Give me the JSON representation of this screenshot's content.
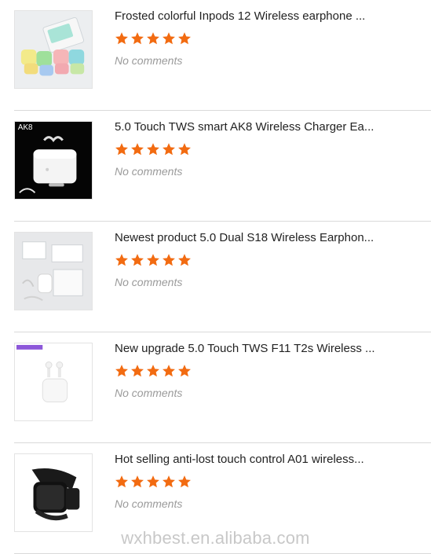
{
  "colors": {
    "star": "#f26b11",
    "divider": "#d9d9d9",
    "title": "#222222",
    "muted": "#9a9a9a"
  },
  "products": [
    {
      "title": "Frosted colorful Inpods 12 Wireless earphone ...",
      "rating": 5,
      "comments": "No comments",
      "image_icon": "colorful-earbuds-image"
    },
    {
      "title": "5.0 Touch TWS smart AK8 Wireless Charger Ea...",
      "rating": 5,
      "comments": "No comments",
      "image_label": "AK8",
      "image_icon": "charging-case-image"
    },
    {
      "title": "Newest product 5.0 Dual S18 Wireless Earphon...",
      "rating": 5,
      "comments": "No comments",
      "image_icon": "earphone-box-set-image"
    },
    {
      "title": "New upgrade 5.0 Touch TWS F11 T2s Wireless ...",
      "rating": 5,
      "comments": "No comments",
      "image_icon": "white-earpods-case-image"
    },
    {
      "title": "Hot selling anti-lost touch control A01 wireless...",
      "rating": 5,
      "comments": "No comments",
      "image_icon": "smart-band-image"
    }
  ],
  "watermark": "wxhbest.en.alibaba.com"
}
